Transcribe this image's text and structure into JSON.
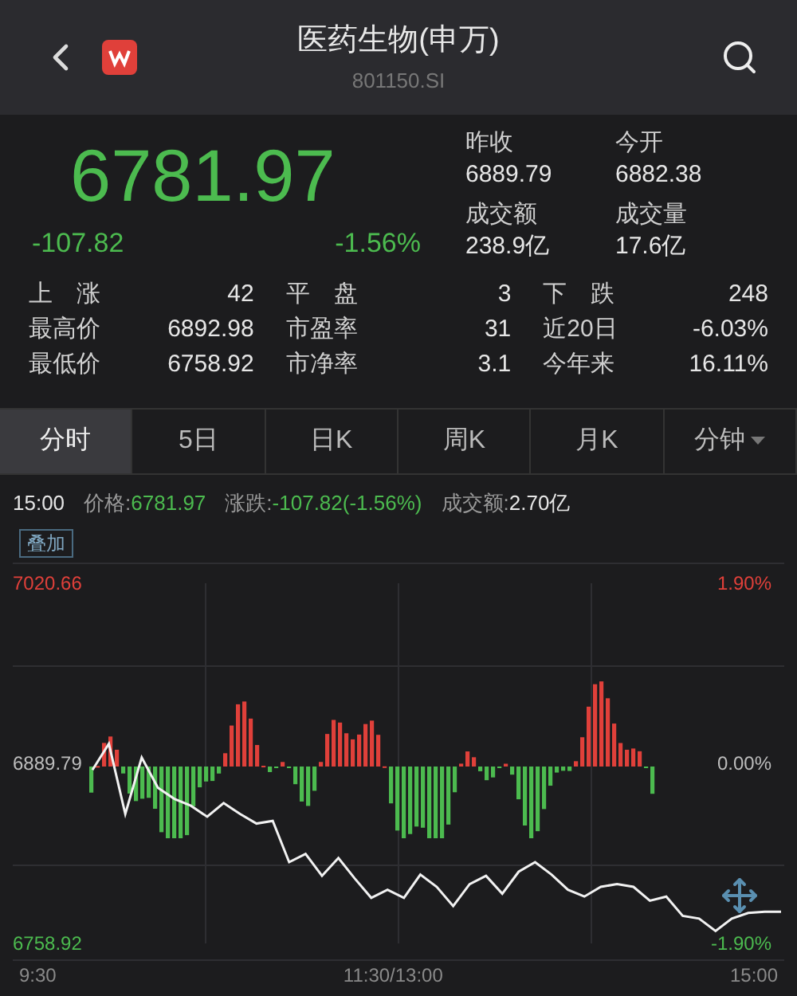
{
  "header": {
    "title": "医药生物(申万)",
    "code": "801150.SI"
  },
  "quote": {
    "price": "6781.97",
    "change": "-107.82",
    "change_pct": "-1.56%",
    "stats": [
      {
        "label": "昨收",
        "value": "6889.79"
      },
      {
        "label": "今开",
        "value": "6882.38"
      },
      {
        "label": "成交额",
        "value": "238.9亿"
      },
      {
        "label": "成交量",
        "value": "17.6亿"
      }
    ]
  },
  "summary": [
    {
      "label": "上　涨",
      "value": "42"
    },
    {
      "label": "平　盘",
      "value": "3"
    },
    {
      "label": "下　跌",
      "value": "248"
    },
    {
      "label": "最高价",
      "value": "6892.98"
    },
    {
      "label": "市盈率",
      "value": "31"
    },
    {
      "label": "近20日",
      "value": "-6.03%"
    },
    {
      "label": "最低价",
      "value": "6758.92"
    },
    {
      "label": "市净率",
      "value": "3.1"
    },
    {
      "label": "今年来",
      "value": "16.11%"
    }
  ],
  "tabs": [
    {
      "label": "分时",
      "selected": true,
      "kind": "tab"
    },
    {
      "label": "5日",
      "selected": false,
      "kind": "tab"
    },
    {
      "label": "日K",
      "selected": false,
      "kind": "tab"
    },
    {
      "label": "周K",
      "selected": false,
      "kind": "tab"
    },
    {
      "label": "月K",
      "selected": false,
      "kind": "tab"
    },
    {
      "label": "分钟",
      "selected": false,
      "kind": "dropdown"
    }
  ],
  "info_bar": {
    "time": "15:00",
    "items": [
      {
        "label": "价格:",
        "value": "6781.97",
        "color": "#4cbb4f"
      },
      {
        "label": "涨跌:",
        "value": "-107.82(-1.56%)",
        "color": "#4cbb4f"
      },
      {
        "label": "成交额:",
        "value": "2.70亿",
        "color": "#e6e6e6"
      }
    ]
  },
  "overlay_button": "叠加",
  "chart": {
    "right_labels": [
      "1.90%",
      "0.00%",
      "-1.90%"
    ],
    "x_labels": [
      "9:30",
      "11:30/13:00",
      "15:00"
    ],
    "chart_data": {
      "type": "line",
      "ylim": [
        6758.92,
        7020.66
      ],
      "yticks": [
        {
          "value": 7020.66,
          "label": "7020.66"
        },
        {
          "value": 6889.79,
          "label": "6889.79"
        },
        {
          "value": 6758.92,
          "label": "6758.92"
        }
      ],
      "series": [
        {
          "color": "#f2f2f2",
          "values": [
            6885,
            6904,
            6853,
            6894,
            6872,
            6864,
            6859,
            6851,
            6861,
            6853,
            6846,
            6848,
            6818,
            6824,
            6808,
            6821,
            6806,
            6792,
            6798,
            6792,
            6809,
            6800,
            6786,
            6802,
            6808,
            6795,
            6811,
            6818,
            6809,
            6798,
            6793,
            6800,
            6802,
            6800,
            6790,
            6793,
            6779,
            6777,
            6768,
            6777,
            6781,
            6782,
            6782
          ]
        }
      ]
    }
  }
}
